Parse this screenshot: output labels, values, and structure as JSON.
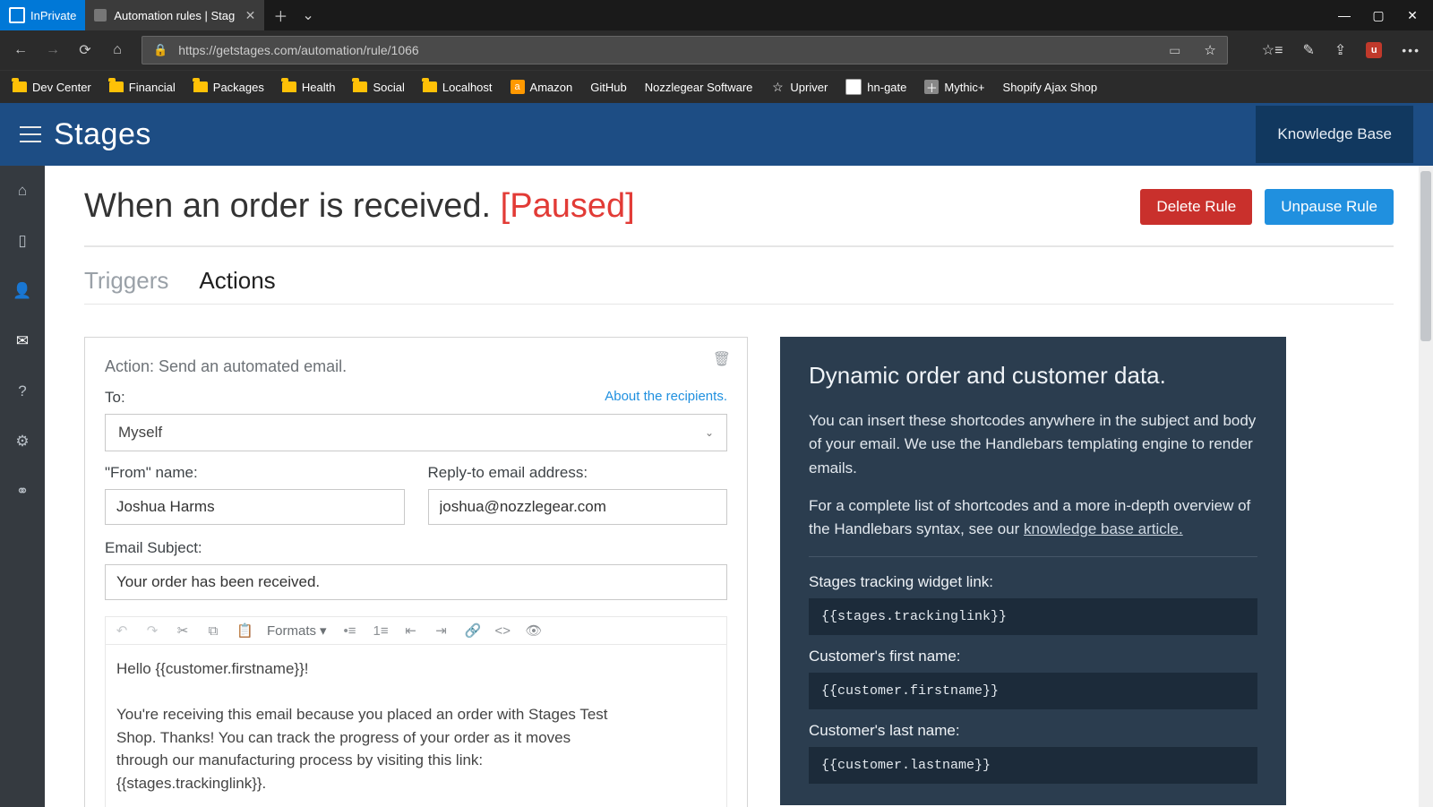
{
  "browser": {
    "inprivate_label": "InPrivate",
    "tab_title": "Automation rules | Stag",
    "url": "https://getstages.com/automation/rule/1066",
    "bookmarks": {
      "dev_center": "Dev Center",
      "financial": "Financial",
      "packages": "Packages",
      "health": "Health",
      "social": "Social",
      "localhost": "Localhost",
      "amazon": "Amazon",
      "github": "GitHub",
      "nozzlegear": "Nozzlegear Software",
      "upriver": "Upriver",
      "hn_gate": "hn-gate",
      "mythic": "Mythic+",
      "ajaxshop": "Shopify Ajax Shop"
    }
  },
  "app": {
    "brand": "Stages",
    "knowledge_base": "Knowledge Base"
  },
  "page": {
    "title_main": "When an order is received.",
    "title_status": "[Paused]",
    "delete_button": "Delete Rule",
    "unpause_button": "Unpause Rule"
  },
  "tabs": {
    "triggers": "Triggers",
    "actions": "Actions"
  },
  "action_card": {
    "title": "Action: Send an automated email.",
    "to_label": "To:",
    "about_recipients": "About the recipients.",
    "to_value": "Myself",
    "from_name_label": "\"From\" name:",
    "from_name_value": "Joshua Harms",
    "reply_to_label": "Reply-to email address:",
    "reply_to_value": "joshua@nozzlegear.com",
    "subject_label": "Email Subject:",
    "subject_value": "Your order has been received."
  },
  "editor": {
    "formats_label": "Formats",
    "body_line1": "Hello {{customer.firstname}}!",
    "body_line2": "You're receiving this email because you placed an order with Stages Test Shop. Thanks! You can track the progress of your order as it moves through our manufacturing process by visiting this link: {{stages.trackinglink}}."
  },
  "help": {
    "header": "Dynamic order and customer data.",
    "para1": "You can insert these shortcodes anywhere in the subject and body of your email. We use the Handlebars templating engine to render emails.",
    "para2_prefix": "For a complete list of shortcodes and a more in-depth overview of the Handlebars syntax, see our ",
    "para2_link": "knowledge base article.",
    "shortcode1_label": "Stages tracking widget link:",
    "shortcode1_value": "{{stages.trackinglink}}",
    "shortcode2_label": "Customer's first name:",
    "shortcode2_value": "{{customer.firstname}}",
    "shortcode3_label": "Customer's last name:",
    "shortcode3_value": "{{customer.lastname}}"
  }
}
